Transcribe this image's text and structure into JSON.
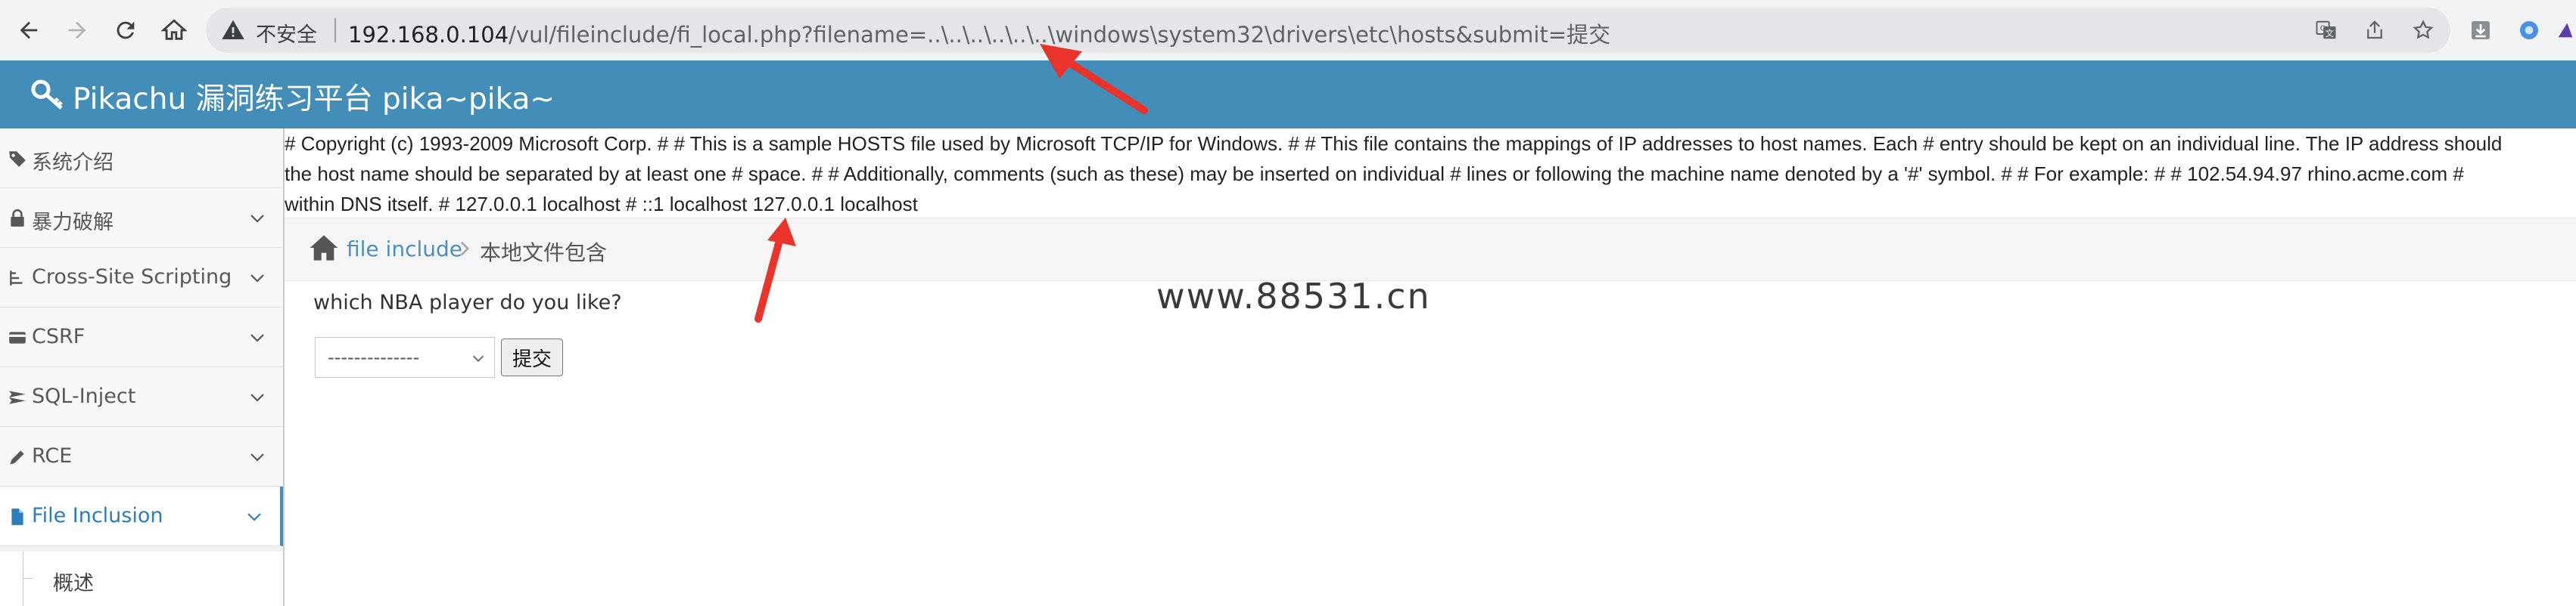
{
  "browser": {
    "security_label": "不安全",
    "url_host": "192.168.0.104",
    "url_rest": "/vul/fileinclude/fi_local.php?filename=..\\..\\..\\..\\..\\..\\windows\\system32\\drivers\\etc\\hosts&submit=提交",
    "toolbar_icons": [
      "back-icon",
      "forward-icon",
      "reload-icon",
      "home-icon"
    ],
    "omnibox_icons": [
      "translate-icon",
      "share-icon",
      "bookmark-star-icon"
    ],
    "extension_icons": [
      "download-icon",
      "extension-icon",
      "profile-icon"
    ]
  },
  "app": {
    "title": "Pikachu 漏洞练习平台 pika~pika~"
  },
  "sidebar": {
    "items": [
      {
        "label": "系统介绍",
        "icon": "tag-icon",
        "has_chevron": false,
        "active": false
      },
      {
        "label": "暴力破解",
        "icon": "lock-icon",
        "has_chevron": true,
        "active": false
      },
      {
        "label": "Cross-Site Scripting",
        "icon": "list-icon",
        "has_chevron": true,
        "active": false
      },
      {
        "label": "CSRF",
        "icon": "credit-card-icon",
        "has_chevron": true,
        "active": false
      },
      {
        "label": "SQL-Inject",
        "icon": "plane-icon",
        "has_chevron": true,
        "active": false
      },
      {
        "label": "RCE",
        "icon": "pencil-icon",
        "has_chevron": true,
        "active": false
      },
      {
        "label": "File Inclusion",
        "icon": "file-icon",
        "has_chevron": true,
        "active": true
      }
    ],
    "sub_item": "概述"
  },
  "file_output": {
    "lines": [
      "# Copyright (c) 1993-2009 Microsoft Corp. # # This is a sample HOSTS file used by Microsoft TCP/IP for Windows. # # This file contains the mappings of IP addresses to host names. Each # entry should be kept on an individual line. The IP address should",
      "the host name should be separated by at least one # space. # # Additionally, comments (such as these) may be inserted on individual # lines or following the machine name denoted by a '#' symbol. # # For example: # # 102.54.94.97 rhino.acme.com #",
      "within DNS itself. # 127.0.0.1 localhost # ::1 localhost 127.0.0.1 localhost"
    ]
  },
  "breadcrumb": {
    "link": "file include",
    "current": "本地文件包含"
  },
  "form": {
    "question": "which NBA player do you like?",
    "select_value": "--------------",
    "submit_label": "提交"
  },
  "watermark": "www.88531.cn",
  "colors": {
    "header_bg": "#438eb9",
    "annotation_arrow": "#e8342a",
    "link": "#4c8fbd"
  }
}
